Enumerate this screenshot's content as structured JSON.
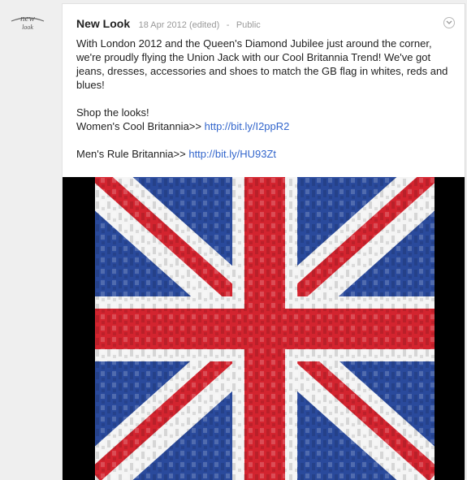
{
  "post": {
    "author": "New Look",
    "date": "18 Apr 2012 (edited)",
    "separator": "-",
    "visibility": "Public",
    "body": "With London 2012 and the Queen's Diamond Jubilee just around the corner, we're proudly flying the Union Jack with our Cool Britannia Trend! We've got jeans, dresses, accessories and shoes to match the GB flag in whites, reds and blues!",
    "shop_heading": "Shop the looks!",
    "womens_label": "Women's Cool Britannia>> ",
    "womens_link": "http://bit.ly/I2ppR2",
    "mens_label": "Men's Rule Britannia>> ",
    "mens_link": "http://bit.ly/HU93Zt"
  },
  "avatar": {
    "logo_text": "new look"
  },
  "icons": {
    "menu": "chevron-down-icon",
    "avatar": "new-look-logo"
  },
  "colors": {
    "link": "#3366cc",
    "flag_red": "#d3242f",
    "flag_blue": "#2a4a9c",
    "flag_white": "#f4f4f4"
  }
}
